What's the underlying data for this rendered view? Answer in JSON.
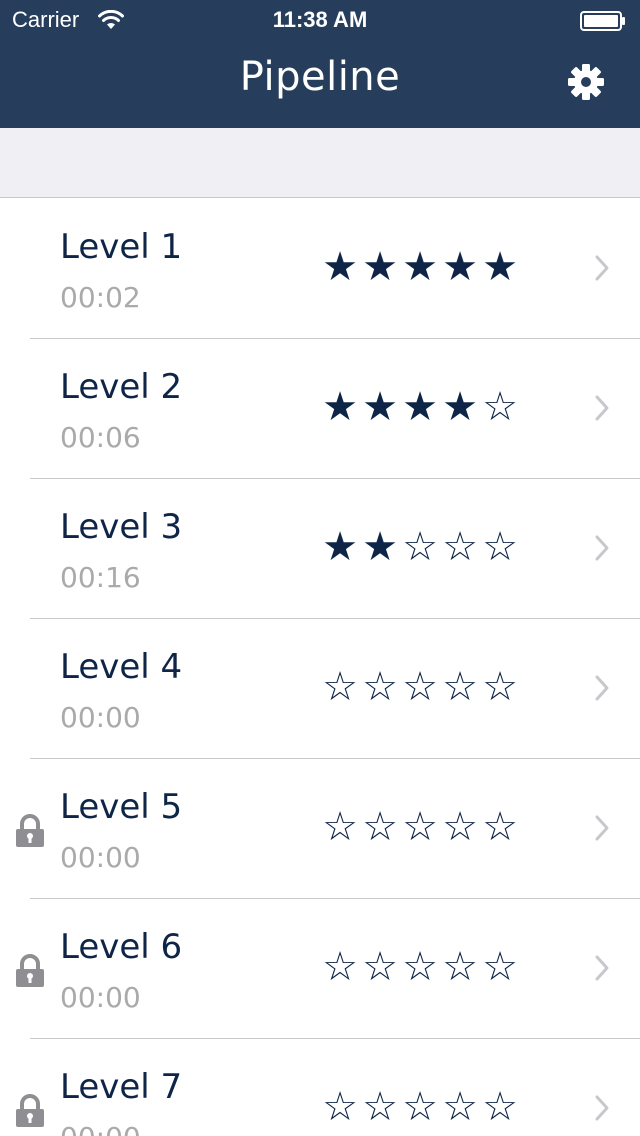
{
  "status_bar": {
    "carrier": "Carrier",
    "time": "11:38 AM"
  },
  "nav": {
    "title": "Pipeline",
    "settings_icon": "gear-icon"
  },
  "colors": {
    "nav_background": "#263d5c",
    "band_background": "#efeff4",
    "star_color": "#0e2547",
    "title_text": "#0e2547",
    "time_text": "#aaaaaa",
    "lock_icon": "#8e8e93",
    "chevron": "#c7c7cc"
  },
  "levels": [
    {
      "name": "Level 1",
      "time": "00:02",
      "stars": 5,
      "max_stars": 5,
      "locked": false
    },
    {
      "name": "Level 2",
      "time": "00:06",
      "stars": 4,
      "max_stars": 5,
      "locked": false
    },
    {
      "name": "Level 3",
      "time": "00:16",
      "stars": 2,
      "max_stars": 5,
      "locked": false
    },
    {
      "name": "Level 4",
      "time": "00:00",
      "stars": 0,
      "max_stars": 5,
      "locked": false
    },
    {
      "name": "Level 5",
      "time": "00:00",
      "stars": 0,
      "max_stars": 5,
      "locked": true
    },
    {
      "name": "Level 6",
      "time": "00:00",
      "stars": 0,
      "max_stars": 5,
      "locked": true
    },
    {
      "name": "Level 7",
      "time": "00:00",
      "stars": 0,
      "max_stars": 5,
      "locked": true
    }
  ]
}
